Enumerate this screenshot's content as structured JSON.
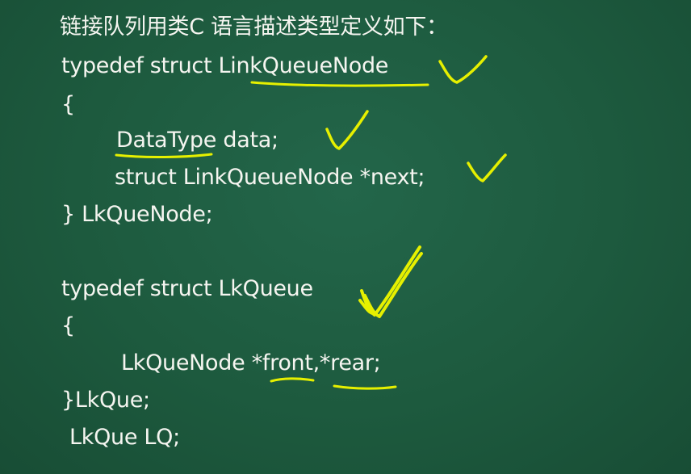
{
  "slide": {
    "heading": "链接队列用类C 语言描述类型定义如下：",
    "lines": [
      "typedef struct LinkQueueNode",
      "{",
      "DataType data;",
      "struct LinkQueueNode *next;",
      "} LkQueNode;",
      "typedef struct LkQueue",
      "{",
      "LkQueNode *front,*rear;",
      "}LkQue;",
      "LkQue LQ;"
    ]
  },
  "colors": {
    "board": "#1e5a3c",
    "text": "#f5f5f0",
    "annotation": "#e6f000"
  }
}
